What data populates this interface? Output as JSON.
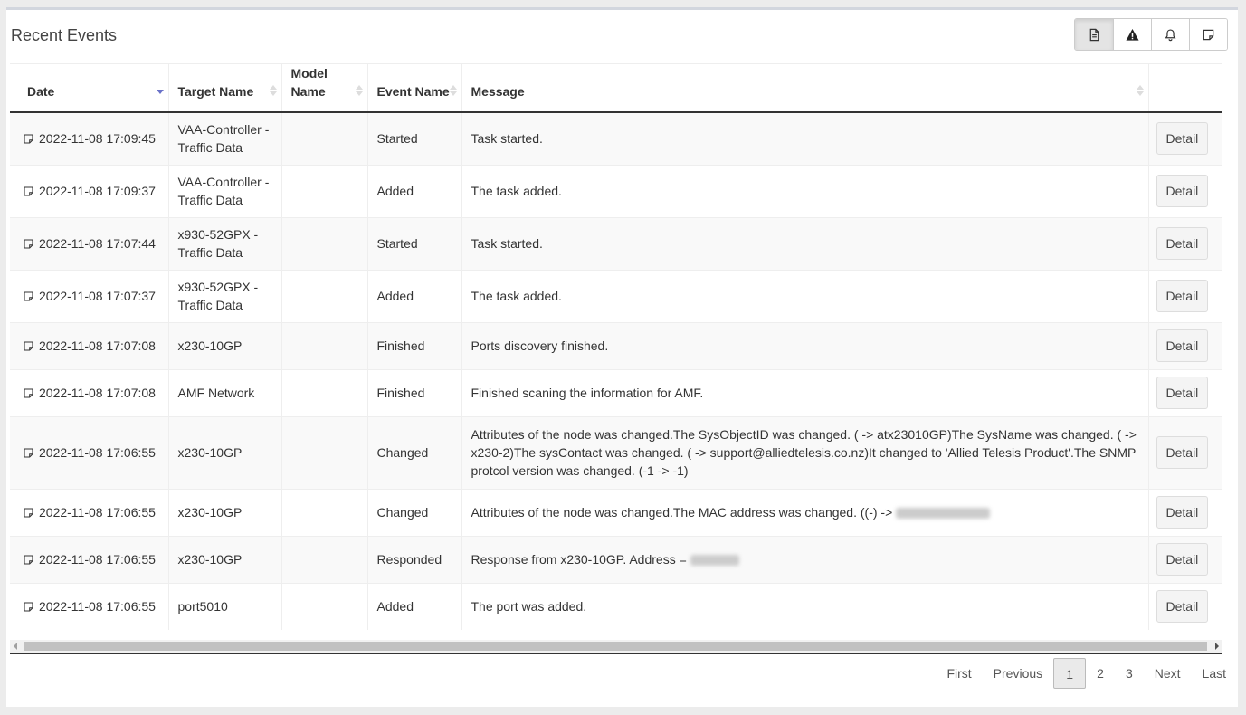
{
  "panel": {
    "title": "Recent Events"
  },
  "toolbar": {
    "buttons": [
      {
        "icon": "document-icon",
        "active": true
      },
      {
        "icon": "warning-icon",
        "active": false
      },
      {
        "icon": "bell-icon",
        "active": false
      },
      {
        "icon": "note-icon",
        "active": false
      }
    ]
  },
  "table": {
    "columns": [
      {
        "key": "date",
        "label": "Date",
        "sorted": "desc"
      },
      {
        "key": "target",
        "label": "Target Name",
        "sortable": true
      },
      {
        "key": "model",
        "label": "Model Name",
        "sortable": true
      },
      {
        "key": "event",
        "label": "Event Name",
        "sortable": true
      },
      {
        "key": "message",
        "label": "Message",
        "sortable": true
      },
      {
        "key": "action",
        "label": ""
      }
    ],
    "detail_label": "Detail",
    "rows": [
      {
        "date": "2022-11-08 17:09:45",
        "target": "VAA-Controller - Traffic Data",
        "model": "",
        "event": "Started",
        "message": "Task started."
      },
      {
        "date": "2022-11-08 17:09:37",
        "target": "VAA-Controller - Traffic Data",
        "model": "",
        "event": "Added",
        "message": "The task added."
      },
      {
        "date": "2022-11-08 17:07:44",
        "target": "x930-52GPX - Traffic Data",
        "model": "",
        "event": "Started",
        "message": "Task started."
      },
      {
        "date": "2022-11-08 17:07:37",
        "target": "x930-52GPX - Traffic Data",
        "model": "",
        "event": "Added",
        "message": "The task added."
      },
      {
        "date": "2022-11-08 17:07:08",
        "target": "x230-10GP",
        "model": "",
        "event": "Finished",
        "message": "Ports discovery finished."
      },
      {
        "date": "2022-11-08 17:07:08",
        "target": "AMF Network",
        "model": "",
        "event": "Finished",
        "message": "Finished scaning the information for AMF."
      },
      {
        "date": "2022-11-08 17:06:55",
        "target": "x230-10GP",
        "model": "",
        "event": "Changed",
        "message": "Attributes of the node was changed.The SysObjectID was changed. ( -> atx23010GP)The SysName was changed. ( -> x230-2)The sysContact was changed. ( -> support@alliedtelesis.co.nz)It changed to 'Allied Telesis Product'.The SNMP protcol version was changed. (-1 -> -1)"
      },
      {
        "date": "2022-11-08 17:06:55",
        "target": "x230-10GP",
        "model": "",
        "event": "Changed",
        "message": "Attributes of the node was changed.The MAC address was changed. ((-) -> "
      },
      {
        "date": "2022-11-08 17:06:55",
        "target": "x230-10GP",
        "model": "",
        "event": "Responded",
        "message": "Response from x230-10GP. Address = "
      },
      {
        "date": "2022-11-08 17:06:55",
        "target": "port5010",
        "model": "",
        "event": "Added",
        "message": "The port was added."
      }
    ]
  },
  "pagination": {
    "first": "First",
    "previous": "Previous",
    "pages": [
      "1",
      "2",
      "3"
    ],
    "current": "1",
    "next": "Next",
    "last": "Last"
  }
}
